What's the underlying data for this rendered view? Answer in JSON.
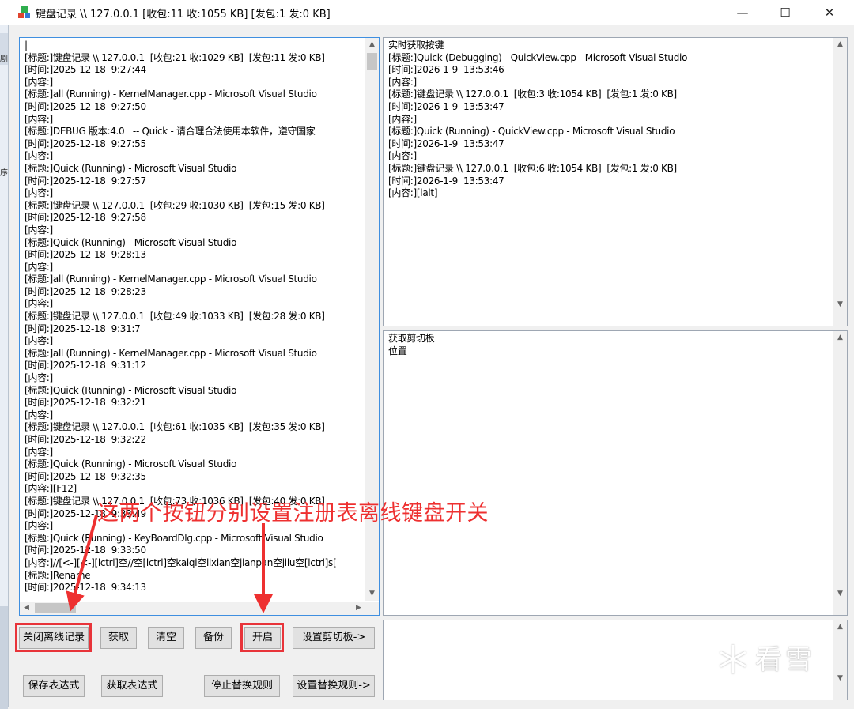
{
  "window": {
    "title": "键盘记录 \\\\ 127.0.0.1  [收包:11 收:1055 KB]  [发包:1 发:0 KB]",
    "controls": {
      "minimize": "—",
      "maximize": "☐",
      "close": "✕"
    }
  },
  "edge_fragments": {
    "top": "剧",
    "mid": "序"
  },
  "log_pane": {
    "lines": [
      "|",
      "[标题:]键盘记录 \\\\ 127.0.0.1  [收包:21 收:1029 KB]  [发包:11 发:0 KB]",
      "[时间:]2025-12-18  9:27:44",
      "[内容:]",
      "[标题:]all (Running) - KernelManager.cpp - Microsoft Visual Studio",
      "[时间:]2025-12-18  9:27:50",
      "[内容:]",
      "[标题:]DEBUG 版本:4.0   -- Quick - 请合理合法使用本软件，遵守国家",
      "[时间:]2025-12-18  9:27:55",
      "[内容:]",
      "[标题:]Quick (Running) - Microsoft Visual Studio",
      "[时间:]2025-12-18  9:27:57",
      "[内容:]",
      "[标题:]键盘记录 \\\\ 127.0.0.1  [收包:29 收:1030 KB]  [发包:15 发:0 KB]",
      "[时间:]2025-12-18  9:27:58",
      "[内容:]",
      "[标题:]Quick (Running) - Microsoft Visual Studio",
      "[时间:]2025-12-18  9:28:13",
      "[内容:]",
      "[标题:]all (Running) - KernelManager.cpp - Microsoft Visual Studio",
      "[时间:]2025-12-18  9:28:23",
      "[内容:]",
      "[标题:]键盘记录 \\\\ 127.0.0.1  [收包:49 收:1033 KB]  [发包:28 发:0 KB]",
      "[时间:]2025-12-18  9:31:7",
      "[内容:]",
      "[标题:]all (Running) - KernelManager.cpp - Microsoft Visual Studio",
      "[时间:]2025-12-18  9:31:12",
      "[内容:]",
      "[标题:]Quick (Running) - Microsoft Visual Studio",
      "[时间:]2025-12-18  9:32:21",
      "[内容:]",
      "[标题:]键盘记录 \\\\ 127.0.0.1  [收包:61 收:1035 KB]  [发包:35 发:0 KB]",
      "[时间:]2025-12-18  9:32:22",
      "[内容:]",
      "[标题:]Quick (Running) - Microsoft Visual Studio",
      "[时间:]2025-12-18  9:32:35",
      "[内容:][F12]",
      "[标题:]键盘记录 \\\\ 127.0.0.1  [收包:73 收:1036 KB]  [发包:40 发:0 KB]",
      "[时间:]2025-12-18  9:33:49",
      "[内容:]",
      "[标题:]Quick (Running) - KeyBoardDlg.cpp - Microsoft Visual Studio",
      "[时间:]2025-12-18  9:33:50",
      "[内容:]//[<-][<-][lctrl]空//空[lctrl]空kaiqi空lixian空jianpan空jilu空[lctrl]s[",
      "[标题:]Rename",
      "[时间:]2025-12-18  9:34:13"
    ]
  },
  "realtime_pane": {
    "lines": [
      "实时获取按键",
      "[标题:]Quick (Debugging) - QuickView.cpp - Microsoft Visual Studio",
      "[时间:]2026-1-9  13:53:46",
      "[内容:]",
      "[标题:]键盘记录 \\\\ 127.0.0.1  [收包:3 收:1054 KB]  [发包:1 发:0 KB]",
      "[时间:]2026-1-9  13:53:47",
      "[内容:]",
      "[标题:]Quick (Running) - QuickView.cpp - Microsoft Visual Studio",
      "[时间:]2026-1-9  13:53:47",
      "[内容:]",
      "[标题:]键盘记录 \\\\ 127.0.0.1  [收包:6 收:1054 KB]  [发包:1 发:0 KB]",
      "[时间:]2026-1-9  13:53:47",
      "[内容:][lalt]"
    ]
  },
  "clipboard_pane": {
    "lines": [
      "获取剪切板",
      "位置"
    ]
  },
  "buttons": {
    "close_offline": "关闭离线记录",
    "fetch": "获取",
    "clear": "清空",
    "backup": "备份",
    "enable": "开启",
    "set_clipboard": "设置剪切板->",
    "save_expr": "保存表达式",
    "get_expr": "获取表达式",
    "stop_replace": "停止替换规则",
    "set_replace": "设置替换规则->"
  },
  "annotation": {
    "text": "这两个按钮分别设置注册表离线键盘开关",
    "color": "#ee3030"
  },
  "watermark": {
    "text": "看雪"
  },
  "colors": {
    "highlight": "#e8343a",
    "focus_border": "#3f8fe0"
  }
}
